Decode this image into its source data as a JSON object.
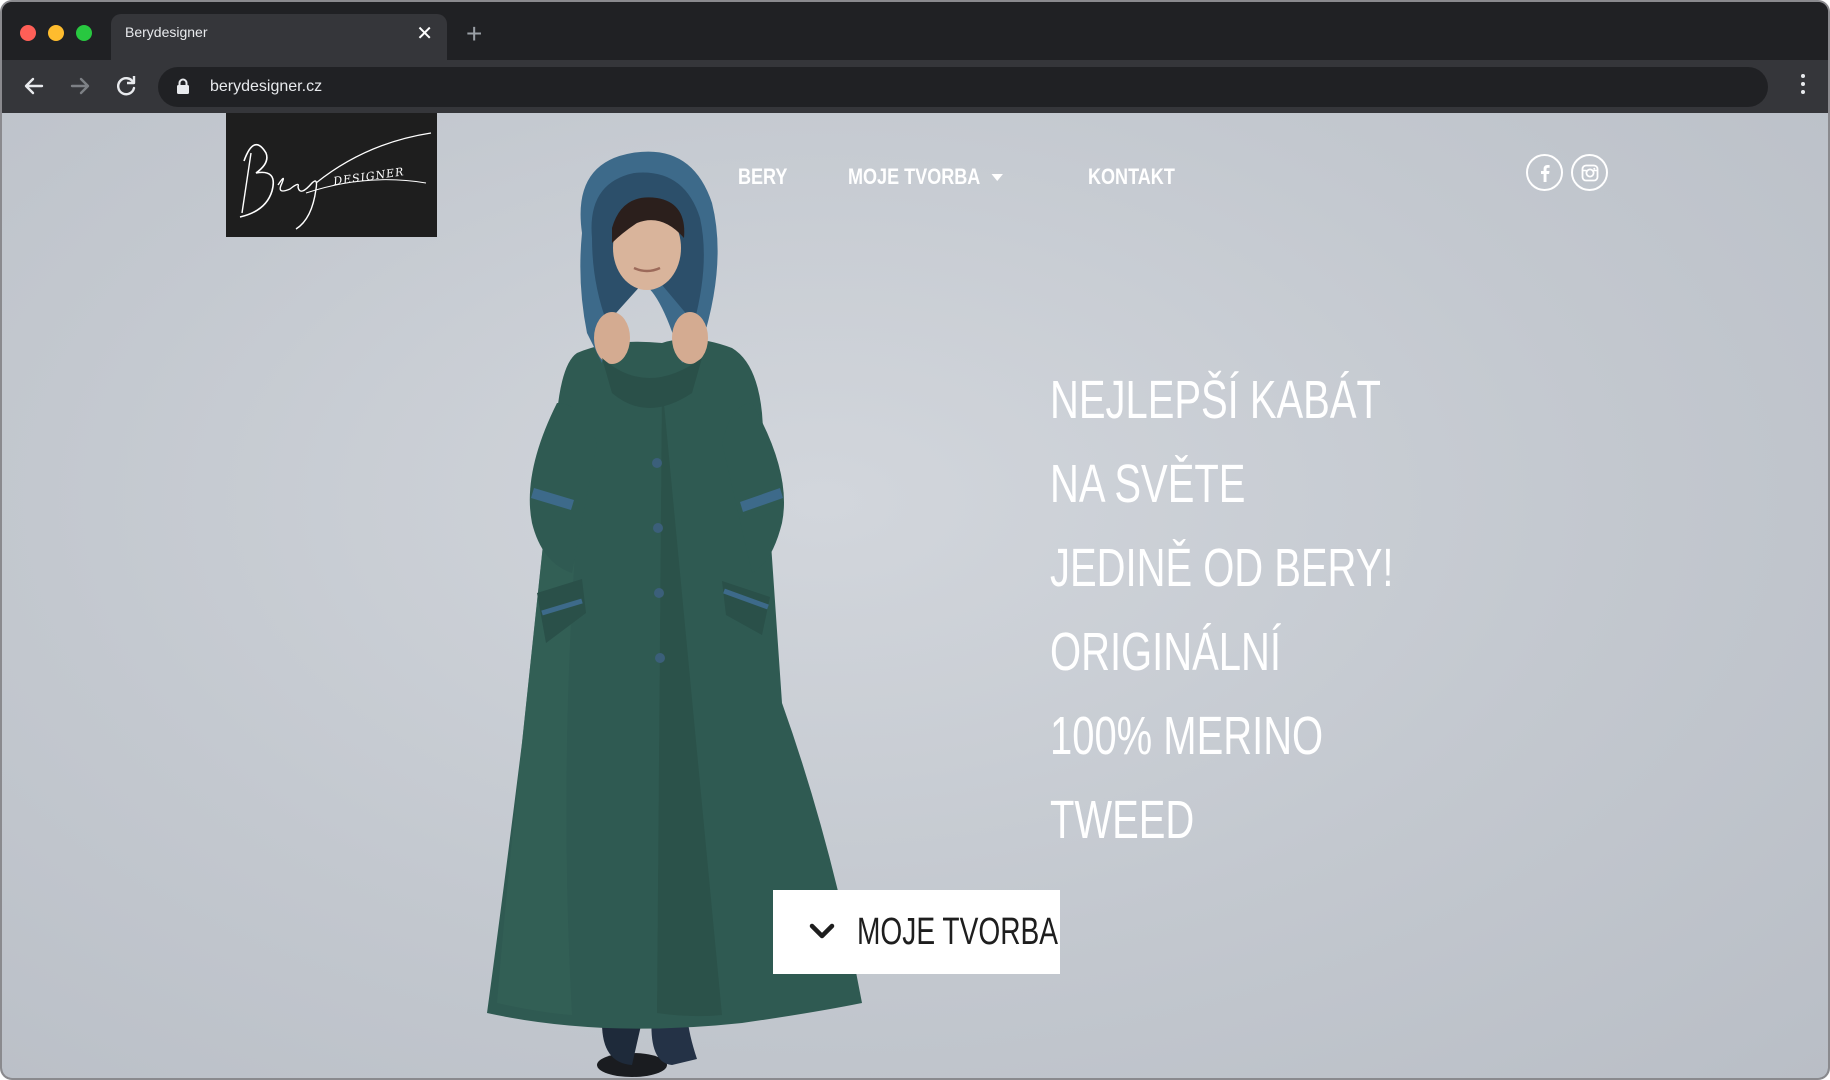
{
  "browser": {
    "tab_title": "Berydesigner",
    "close_glyph": "✕",
    "new_tab_glyph": "+",
    "url": "berydesigner.cz"
  },
  "site": {
    "logo_text": "Bery DESIGNER",
    "nav": {
      "bery": "BERY",
      "moje_tvorba": "MOJE TVORBA",
      "kontakt": "KONTAKT"
    },
    "social": [
      "facebook-icon",
      "instagram-icon"
    ],
    "headline": [
      "NEJLEPŠÍ KABÁT",
      "NA SVĚTE",
      "JEDINĚ OD BERY!",
      "ORIGINÁLNÍ",
      "100% MERINO",
      "TWEED"
    ],
    "cta_label": "MOJE TVORBA"
  },
  "colors": {
    "coat": "#2f5a52",
    "hood_lining": "#3d6a8a",
    "background": "#c6cbd2",
    "logo_bg": "#1e1e1e"
  }
}
